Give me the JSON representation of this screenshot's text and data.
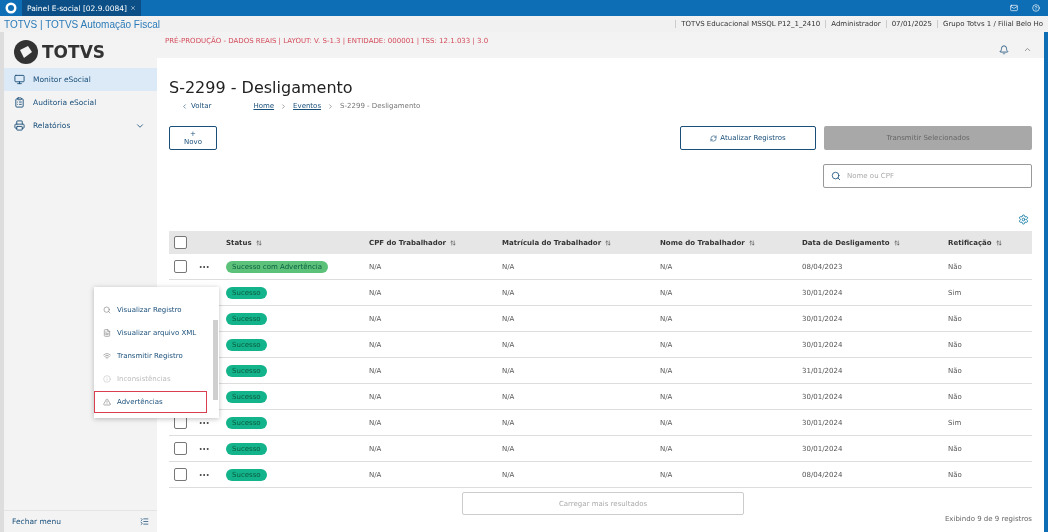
{
  "app_tab": {
    "label": "Painel E-social [02.9.0084]"
  },
  "window": {
    "title": "TOTVS | TOTVS Automação Fiscal",
    "info": [
      "TOTVS Educacional MSSQL P12_1_2410",
      "Administrador",
      "07/01/2025",
      "Grupo Totvs 1 / Filial Belo Ho"
    ]
  },
  "logo": {
    "text": "TOTVS"
  },
  "sidebar": {
    "items": [
      {
        "label": "Monitor eSocial",
        "selected": true,
        "expandable": false
      },
      {
        "label": "Auditoria eSocial",
        "selected": false,
        "expandable": false
      },
      {
        "label": "Relatórios",
        "selected": false,
        "expandable": true
      }
    ],
    "close_label": "Fechar menu"
  },
  "environment": "PRÉ-PRODUÇÃO - DADOS REAIS | LAYOUT: V. S-1.3 | ENTIDADE: 000001 | TSS: 12.1.033 | 3.0",
  "page": {
    "title": "S-2299 - Desligamento",
    "back": "Voltar",
    "breadcrumb": [
      {
        "label": "Home",
        "link": true
      },
      {
        "label": "Eventos",
        "link": true
      },
      {
        "label": "S-2299 - Desligamento",
        "link": false
      }
    ]
  },
  "actions": {
    "new": "+ Novo",
    "refresh": "Atualizar Registros",
    "transmit": {
      "label": "Transmitir Selecionados",
      "disabled": true
    }
  },
  "search": {
    "placeholder": "Nome ou CPF"
  },
  "table": {
    "select_all_checked": false,
    "columns": [
      "Status",
      "CPF do Trabalhador",
      "Matrícula do Trabalhador",
      "Nome do Trabalhador",
      "Data de Desligamento",
      "Retificação"
    ],
    "rows": [
      {
        "checked": false,
        "status": "Sucesso com Advertência",
        "color": "#5cc27a",
        "cpf": "N/A",
        "matricula": "N/A",
        "nome": "N/A",
        "data": "08/04/2023",
        "retificacao": "Não"
      },
      {
        "status": "Sucesso",
        "color": "#13b38b",
        "cpf": "N/A",
        "matricula": "N/A",
        "nome": "N/A",
        "data": "30/01/2024",
        "retificacao": "Sim"
      },
      {
        "status": "Sucesso",
        "color": "#13b38b",
        "cpf": "N/A",
        "matricula": "N/A",
        "nome": "N/A",
        "data": "30/01/2024",
        "retificacao": "Não"
      },
      {
        "status": "Sucesso",
        "color": "#13b38b",
        "cpf": "N/A",
        "matricula": "N/A",
        "nome": "N/A",
        "data": "30/01/2024",
        "retificacao": "Não"
      },
      {
        "status": "Sucesso",
        "color": "#13b38b",
        "cpf": "N/A",
        "matricula": "N/A",
        "nome": "N/A",
        "data": "31/01/2024",
        "retificacao": "Não"
      },
      {
        "status": "Sucesso",
        "color": "#13b38b",
        "cpf": "N/A",
        "matricula": "N/A",
        "nome": "N/A",
        "data": "30/01/2024",
        "retificacao": "Não"
      },
      {
        "checked": false,
        "status": "Sucesso",
        "color": "#13b38b",
        "cpf": "N/A",
        "matricula": "N/A",
        "nome": "N/A",
        "data": "30/01/2024",
        "retificacao": "Sim"
      },
      {
        "checked": false,
        "status": "Sucesso",
        "color": "#13b38b",
        "cpf": "N/A",
        "matricula": "N/A",
        "nome": "N/A",
        "data": "30/01/2024",
        "retificacao": "Não"
      },
      {
        "checked": false,
        "status": "Sucesso",
        "color": "#13b38b",
        "cpf": "N/A",
        "matricula": "N/A",
        "nome": "N/A",
        "data": "08/04/2024",
        "retificacao": "Não"
      }
    ],
    "load_more": "Carregar mais resultados",
    "footer": "Exibindo 9 de 9 registros"
  },
  "row_menu": {
    "items": [
      {
        "label": "Visualizar Registro",
        "disabled": false,
        "selected": false
      },
      {
        "label": "Visualizar arquivo XML",
        "disabled": false,
        "selected": false
      },
      {
        "label": "Transmitir Registro",
        "disabled": false,
        "selected": false
      },
      {
        "label": "Inconsistências",
        "disabled": true,
        "selected": false
      },
      {
        "label": "Advertências",
        "disabled": false,
        "selected": true
      }
    ]
  }
}
